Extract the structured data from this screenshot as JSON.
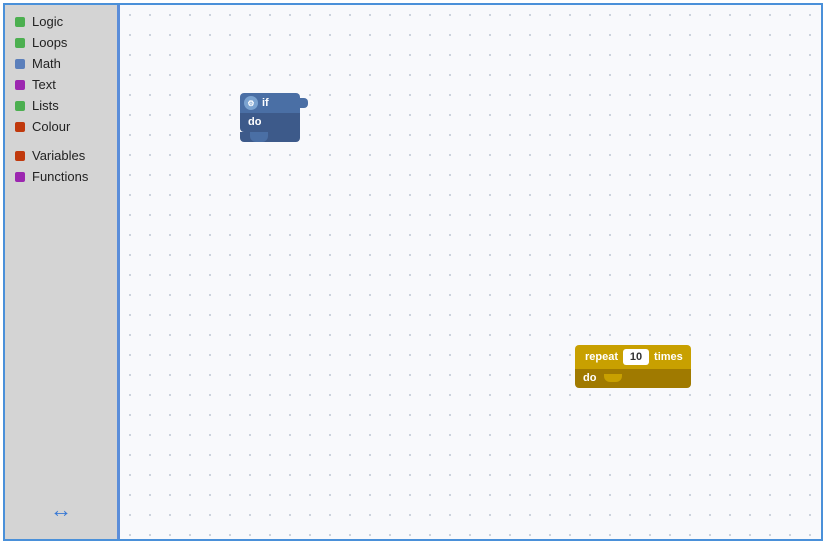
{
  "sidebar": {
    "items": [
      {
        "label": "Logic",
        "color": "#4CAF50"
      },
      {
        "label": "Loops",
        "color": "#4CAF50"
      },
      {
        "label": "Math",
        "color": "#5B7FBB"
      },
      {
        "label": "Text",
        "color": "#9C27B0"
      },
      {
        "label": "Lists",
        "color": "#4CAF50"
      },
      {
        "label": "Colour",
        "color": "#c0390d"
      }
    ],
    "items2": [
      {
        "label": "Variables",
        "color": "#c0390d"
      },
      {
        "label": "Functions",
        "color": "#9C27B0"
      }
    ]
  },
  "if_block": {
    "if_label": "if",
    "do_label": "do"
  },
  "repeat_block": {
    "repeat_label": "repeat",
    "times_label": "times",
    "do_label": "do",
    "count": "10"
  },
  "resize_icon": "↔"
}
